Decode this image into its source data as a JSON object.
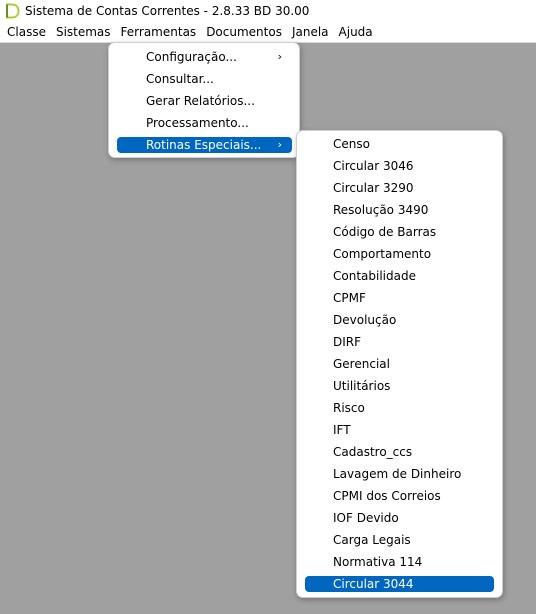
{
  "window": {
    "title": "Sistema de Contas Correntes - 2.8.33 BD 30.00",
    "icon": "app-logo-icon",
    "accent_color": "#0067c0",
    "workspace_color": "#a0a0a0"
  },
  "menubar": {
    "items": [
      "Classe",
      "Sistemas",
      "Ferramentas",
      "Documentos",
      "Janela",
      "Ajuda"
    ]
  },
  "ferramentas_menu": {
    "items": [
      {
        "label": "Configuração...",
        "submenu": true,
        "arrow": "›"
      },
      {
        "label": "Consultar..."
      },
      {
        "label": "Gerar Relatórios..."
      },
      {
        "label": "Processamento..."
      },
      {
        "label": "Rotinas Especiais...",
        "submenu": true,
        "arrow": "›",
        "highlighted": true
      }
    ]
  },
  "rotinas_menu": {
    "items": [
      "Censo",
      "Circular 3046",
      "Circular 3290",
      "Resolução 3490",
      "Código de Barras",
      "Comportamento",
      "Contabilidade",
      "CPMF",
      "Devolução",
      "DIRF",
      "Gerencial",
      "Utilitários",
      "Risco",
      "IFT",
      "Cadastro_ccs",
      "Lavagem de Dinheiro",
      "CPMI dos Correios",
      "IOF Devido",
      "Carga Legais",
      "Normativa 114",
      "Circular 3044"
    ],
    "highlighted_index": 20
  }
}
